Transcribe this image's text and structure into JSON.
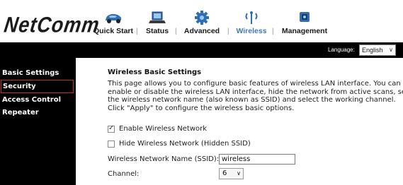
{
  "logo_text": "NetComm",
  "nav": {
    "items": [
      {
        "label": "Quick Start",
        "icon": "car-icon"
      },
      {
        "label": "Status",
        "icon": "laptop-icon"
      },
      {
        "label": "Advanced",
        "icon": "gear-icon"
      },
      {
        "label": "Wireless",
        "icon": "wireless-icon"
      },
      {
        "label": "Management",
        "icon": "management-icon"
      }
    ],
    "separator": "|",
    "active_index": 3,
    "active_color": "#3f78c6"
  },
  "language": {
    "label": "Language:",
    "selected": "English"
  },
  "sidebar": {
    "items": [
      {
        "label": "Basic Settings"
      },
      {
        "label": "Security"
      },
      {
        "label": "Access Control"
      },
      {
        "label": "Repeater"
      }
    ],
    "selected_index": 1,
    "highlight_color": "#d0262a"
  },
  "main": {
    "title": "Wireless Basic Settings",
    "description": "This page allows you to configure basic features of wireless LAN interface. You can enable or disable the wireless LAN interface, hide the network from active scans, set the wireless network name (also known as SSID) and select the working channel. Click \"Apply\" to configure the wireless basic options.",
    "enable_wireless": {
      "label": "Enable Wireless Network",
      "checked": true
    },
    "hide_ssid": {
      "label": "Hide Wireless Network (Hidden SSID)",
      "checked": false
    },
    "ssid": {
      "label": "Wireless Network Name (SSID):",
      "value": "wireless"
    },
    "channel": {
      "label": "Channel:",
      "value": "6"
    }
  }
}
